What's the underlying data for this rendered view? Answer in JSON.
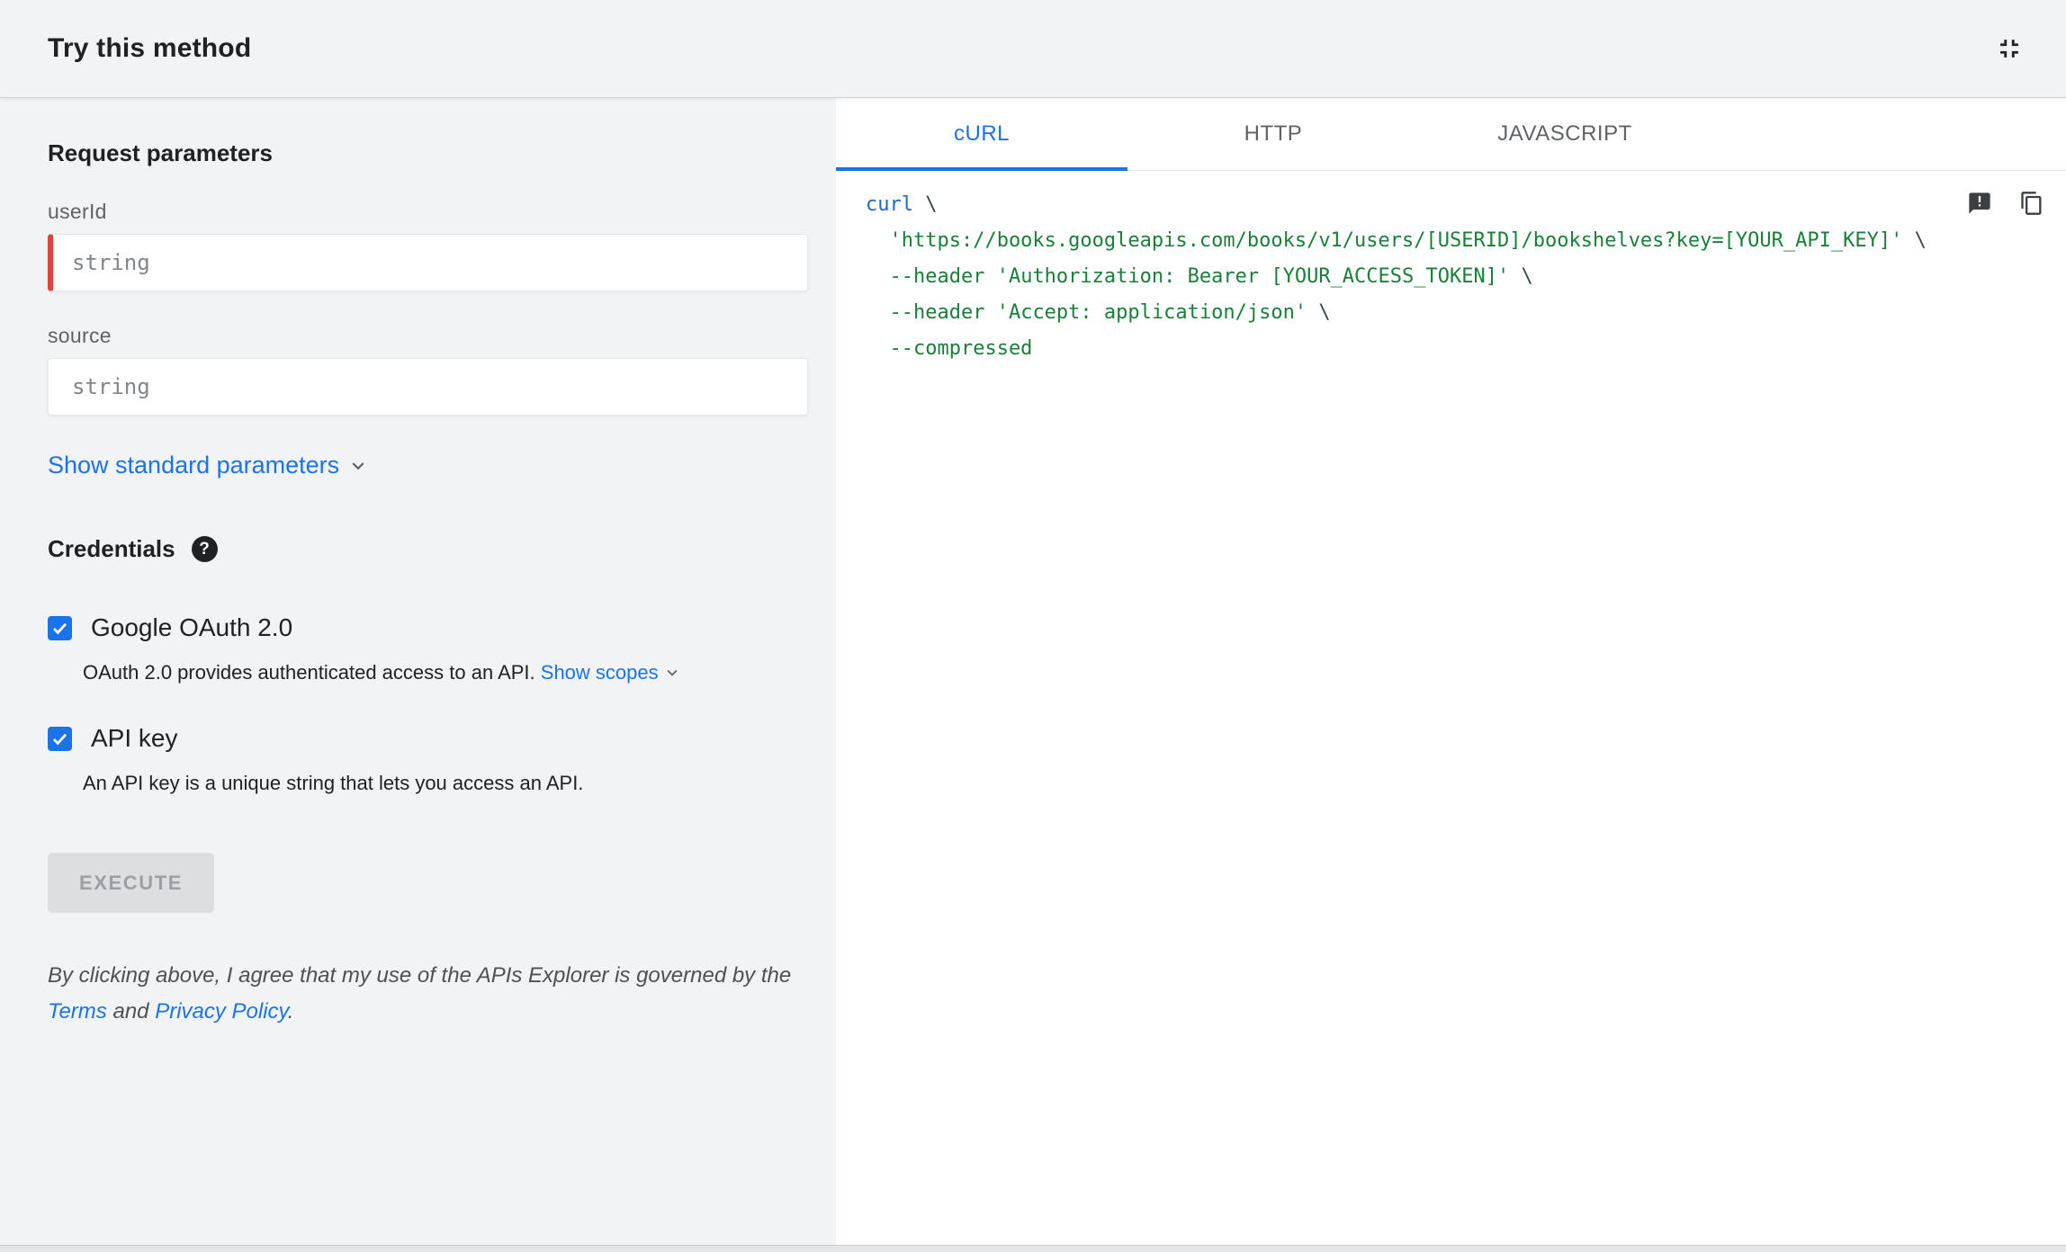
{
  "header": {
    "title": "Try this method"
  },
  "params": {
    "section_title": "Request parameters",
    "fields": [
      {
        "label": "userId",
        "placeholder": "string",
        "required": true
      },
      {
        "label": "source",
        "placeholder": "string",
        "required": false
      }
    ],
    "show_standard": "Show standard parameters"
  },
  "credentials": {
    "section_title": "Credentials",
    "oauth": {
      "label": "Google OAuth 2.0",
      "checked": true,
      "description": "OAuth 2.0 provides authenticated access to an API. ",
      "show_scopes": "Show scopes"
    },
    "api_key": {
      "label": "API key",
      "checked": true,
      "description": "An API key is a unique string that lets you access an API."
    }
  },
  "execute": {
    "label": "EXECUTE"
  },
  "disclaimer": {
    "text_before": "By clicking above, I agree that my use of the APIs Explorer is governed by the ",
    "terms": "Terms",
    "middle": " and ",
    "privacy": "Privacy Policy",
    "end": "."
  },
  "tabs": [
    {
      "label": "cURL",
      "active": true
    },
    {
      "label": "HTTP",
      "active": false
    },
    {
      "label": "JAVASCRIPT",
      "active": false
    }
  ],
  "code": {
    "lines": [
      [
        {
          "text": "curl",
          "color": "kw"
        },
        {
          "text": " \\",
          "color": "plain"
        }
      ],
      [
        {
          "text": "  'https://books.googleapis.com/books/v1/users/[USERID]/bookshelves?key=[YOUR_API_KEY]'",
          "color": "str"
        },
        {
          "text": " \\",
          "color": "plain"
        }
      ],
      [
        {
          "text": "  --header ",
          "color": "flag"
        },
        {
          "text": "'Authorization: Bearer [YOUR_ACCESS_TOKEN]'",
          "color": "str"
        },
        {
          "text": " \\",
          "color": "plain"
        }
      ],
      [
        {
          "text": "  --header ",
          "color": "flag"
        },
        {
          "text": "'Accept: application/json'",
          "color": "str"
        },
        {
          "text": " \\",
          "color": "plain"
        }
      ],
      [
        {
          "text": "  --compressed",
          "color": "flag"
        }
      ]
    ]
  },
  "icons": {
    "header_right": "fullscreen-exit-icon",
    "credentials_help": "help-icon",
    "checkbox": "check-icon",
    "links": "chevron-down-icon",
    "code_top_right": [
      "feedback-icon",
      "copy-icon"
    ]
  },
  "colors": {
    "accent": "#1a73e8",
    "required_red": "#df4437",
    "tab_inactive": "#5f6368",
    "code_keyword": "#1967d2",
    "code_string": "#188038",
    "code_flag": "#188038",
    "code_plain": "#37474f",
    "left_panel_bg": "#f1f3f4",
    "right_panel_bg": "#ffffff"
  }
}
